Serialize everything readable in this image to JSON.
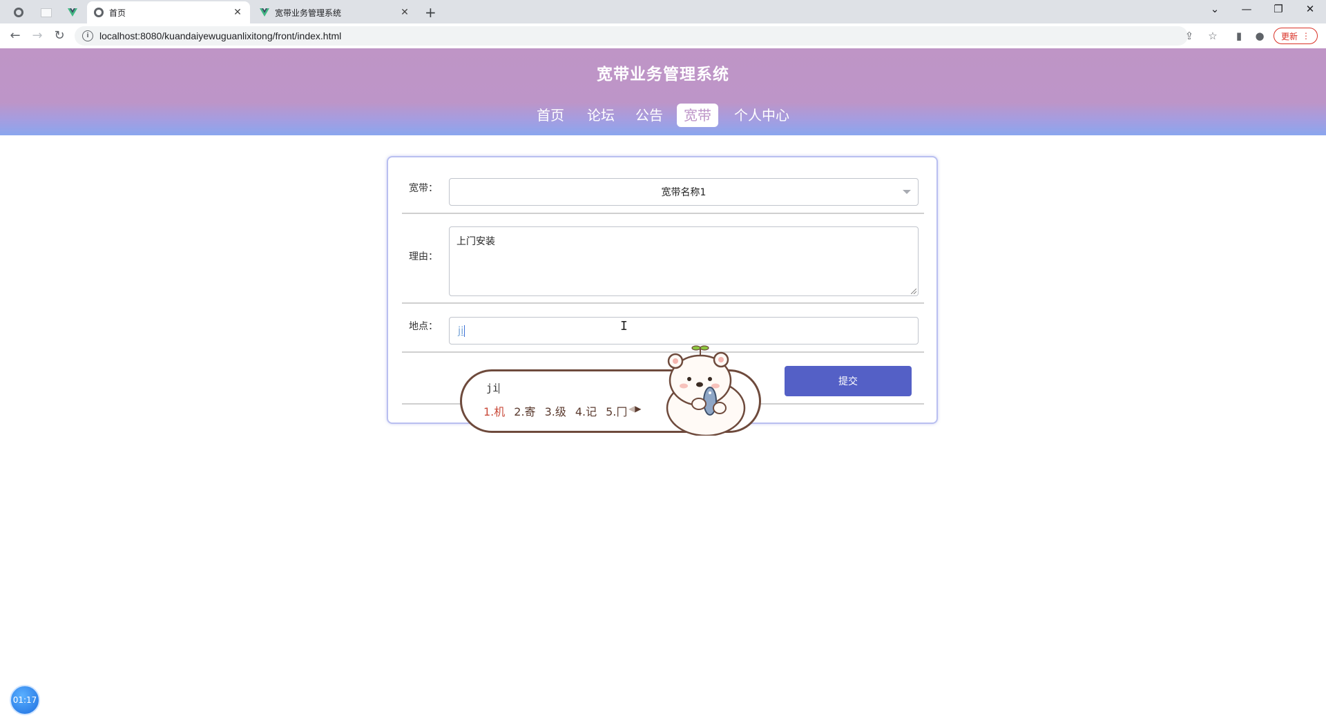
{
  "browser": {
    "tabs": [
      {
        "title": "首页",
        "active": true,
        "icon": "globe-icon"
      },
      {
        "title": "宽带业务管理系统",
        "active": false,
        "icon": "vue-icon"
      }
    ],
    "new_tab_label": "+",
    "tab_close": "✕",
    "url": "localhost:8080/kuandaiyewuguanlixitong/front/index.html",
    "update_label": "更新"
  },
  "site": {
    "title": "宽带业务管理系统",
    "nav": [
      {
        "label": "首页",
        "active": false
      },
      {
        "label": "论坛",
        "active": false
      },
      {
        "label": "公告",
        "active": false
      },
      {
        "label": "宽带",
        "active": true
      },
      {
        "label": "个人中心",
        "active": false
      }
    ]
  },
  "form": {
    "broadband_label": "宽带：",
    "broadband_value": "宽带名称1",
    "reason_label": "理由：",
    "reason_value": "上门安装",
    "location_label": "地点：",
    "location_value": "ji",
    "submit_label": "提交"
  },
  "ime": {
    "pinyin": "ji",
    "candidates": [
      "1.机",
      "2.寄",
      "3.级",
      "4.记",
      "5.冂"
    ]
  },
  "timer": {
    "value": "01:17"
  },
  "colors": {
    "header_top": "#bf95c6",
    "header_bottom": "#8aa6ee",
    "submit_button": "#5460c6",
    "card_border": "#b9bff0"
  }
}
